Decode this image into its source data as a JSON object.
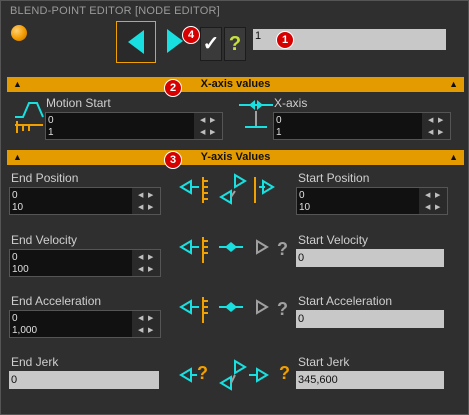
{
  "window": {
    "title": "BLEND-POINT EDITOR [NODE EDITOR]"
  },
  "toolbar": {
    "ok_label": "✓",
    "help_label": "?",
    "name_value": "1"
  },
  "badges": [
    "1",
    "2",
    "3",
    "4"
  ],
  "x_section": {
    "title": "X-axis values",
    "left": {
      "label": "Motion Start",
      "values": [
        "0",
        "1"
      ]
    },
    "right": {
      "label": "X-axis",
      "values": [
        "0",
        "1"
      ]
    }
  },
  "y_section": {
    "title": "Y-axis Values",
    "rows": [
      {
        "left_label": "End Position",
        "left_values": [
          "0",
          "10"
        ],
        "right_label": "Start Position",
        "right_values": [
          "0",
          "10"
        ]
      },
      {
        "left_label": "End Velocity",
        "left_values": [
          "0",
          "100"
        ],
        "right_label": "Start Velocity",
        "right_value": "0"
      },
      {
        "left_label": "End Acceleration",
        "left_values": [
          "0",
          "1,000"
        ],
        "right_label": "Start Acceleration",
        "right_value": "0"
      },
      {
        "left_label": "End Jerk",
        "left_value": "0",
        "right_label": "Start Jerk",
        "right_value": "345,600"
      }
    ]
  },
  "colors": {
    "accent": "#e39b00",
    "cyan": "#19e0e0",
    "orange": "#f0a000"
  }
}
